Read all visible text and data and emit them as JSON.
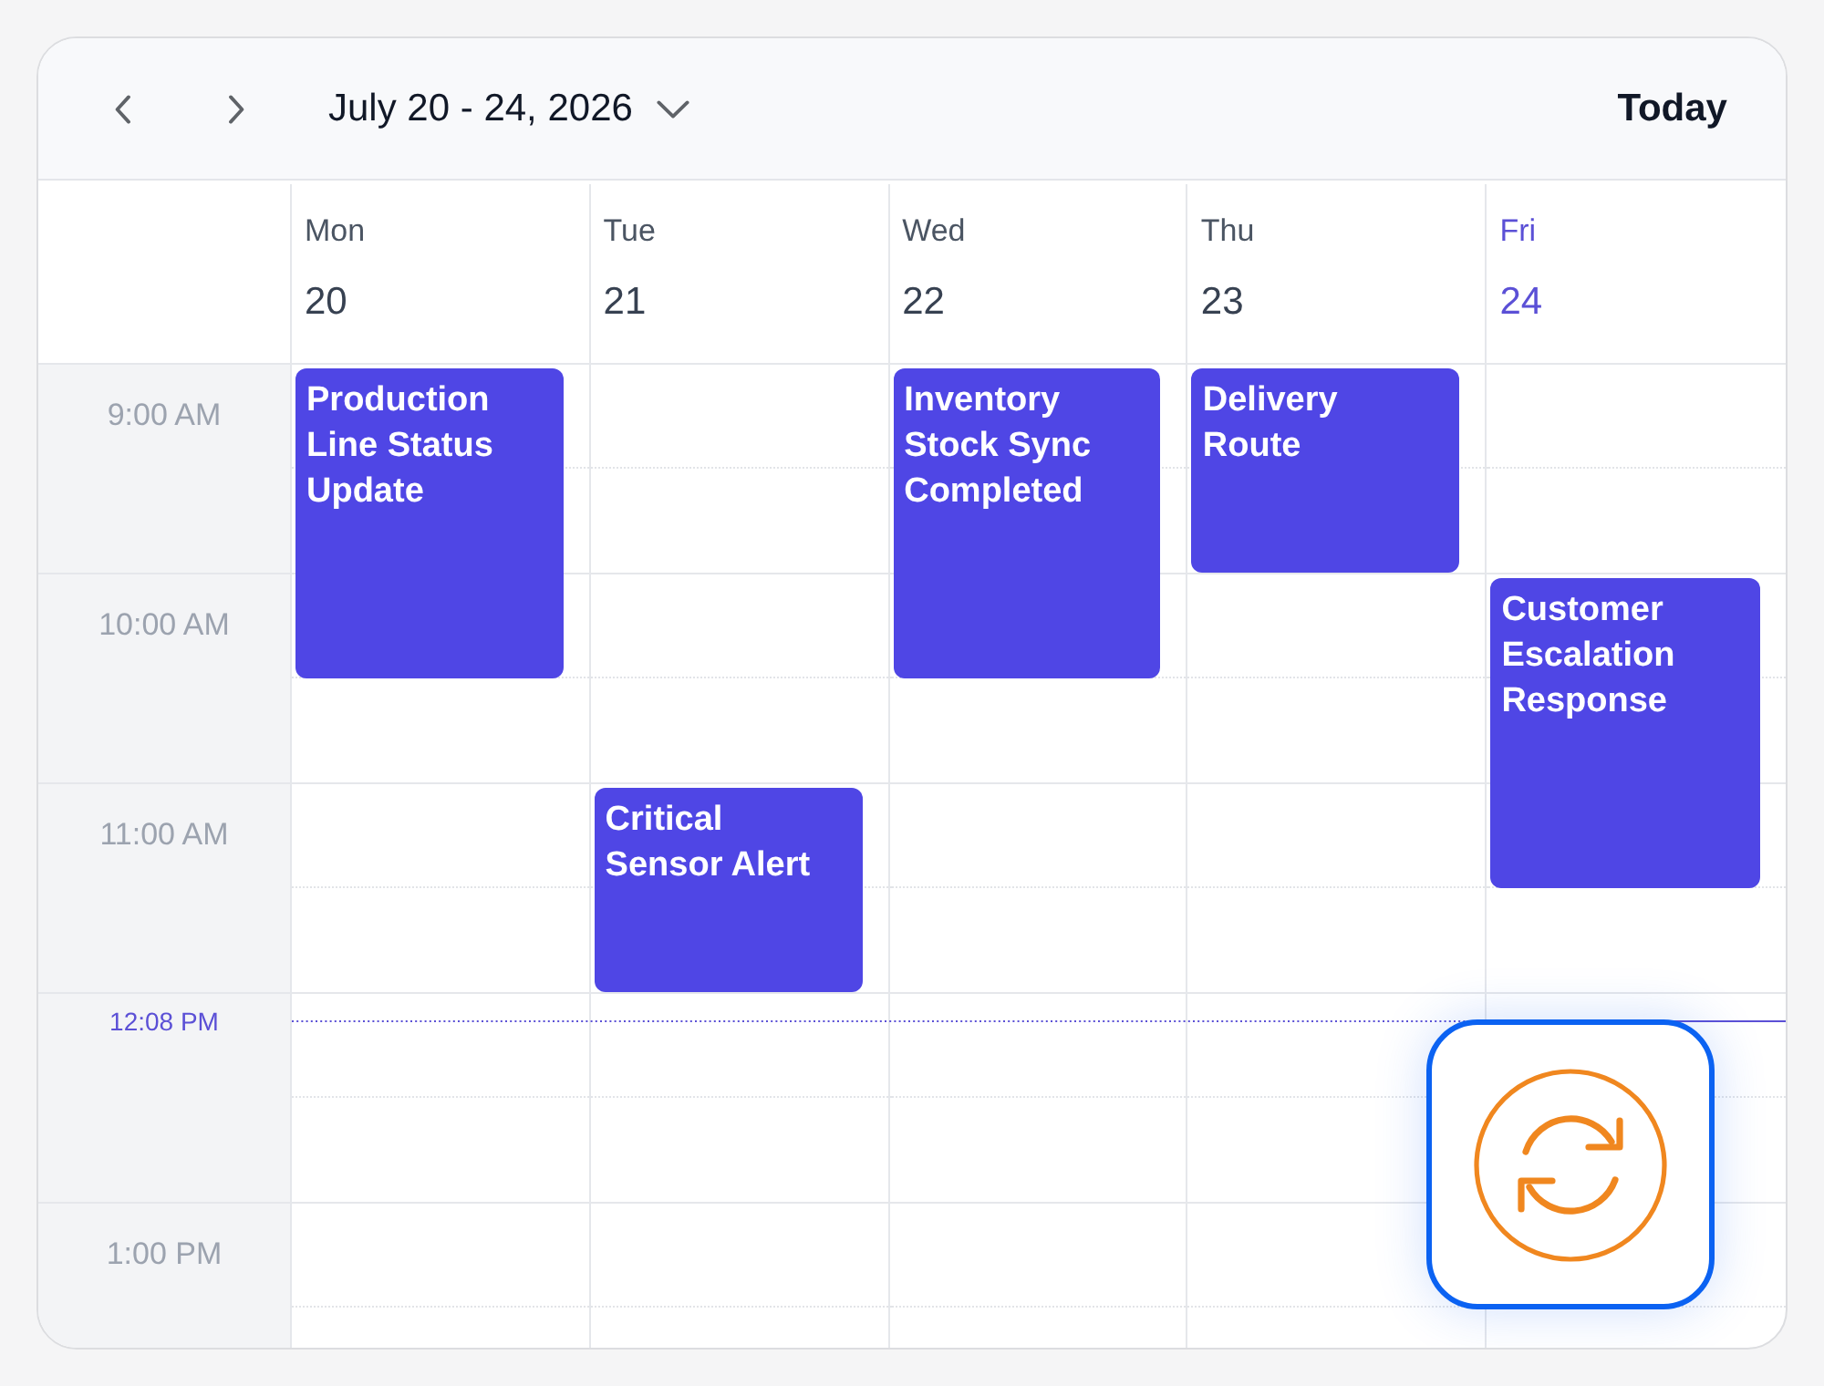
{
  "toolbar": {
    "date_range": "July 20 - 24, 2026",
    "today_button": "Today"
  },
  "days": [
    {
      "name": "Mon",
      "date": "20",
      "selected": false
    },
    {
      "name": "Tue",
      "date": "21",
      "selected": false
    },
    {
      "name": "Wed",
      "date": "22",
      "selected": false
    },
    {
      "name": "Thu",
      "date": "23",
      "selected": false
    },
    {
      "name": "Fri",
      "date": "24",
      "selected": true
    }
  ],
  "time_rows": [
    {
      "kind": "hour",
      "label": "9:00 AM",
      "cells": [
        {
          "kind": "long",
          "title": "Production Line Status Update"
        },
        {
          "kind": "free"
        },
        {
          "kind": "long",
          "title": "Inventory Stock Sync Completed"
        },
        {
          "kind": "short",
          "title": "Delivery Route"
        },
        {
          "kind": "free"
        }
      ]
    },
    {
      "kind": "hour",
      "label": "10:00 AM",
      "cells": [
        {
          "kind": "free"
        },
        {
          "kind": "free"
        },
        {
          "kind": "free"
        },
        {
          "kind": "free"
        },
        {
          "kind": "long",
          "title": "Customer Escalation Response"
        }
      ]
    },
    {
      "kind": "hour",
      "label": "11:00 AM",
      "cells": [
        {
          "kind": "free"
        },
        {
          "kind": "short",
          "title": "Critical Sensor Alert"
        },
        {
          "kind": "free"
        },
        {
          "kind": "free"
        },
        {
          "kind": "free"
        }
      ]
    },
    {
      "kind": "now",
      "label": "12:08 PM",
      "cells": [
        {
          "kind": "free"
        },
        {
          "kind": "free"
        },
        {
          "kind": "free"
        },
        {
          "kind": "free"
        },
        {
          "kind": "free"
        }
      ]
    },
    {
      "kind": "hour",
      "label": "1:00 PM",
      "cells": [
        {
          "kind": "free"
        },
        {
          "kind": "free"
        },
        {
          "kind": "free"
        },
        {
          "kind": "free"
        },
        {
          "kind": "free"
        }
      ]
    }
  ]
}
